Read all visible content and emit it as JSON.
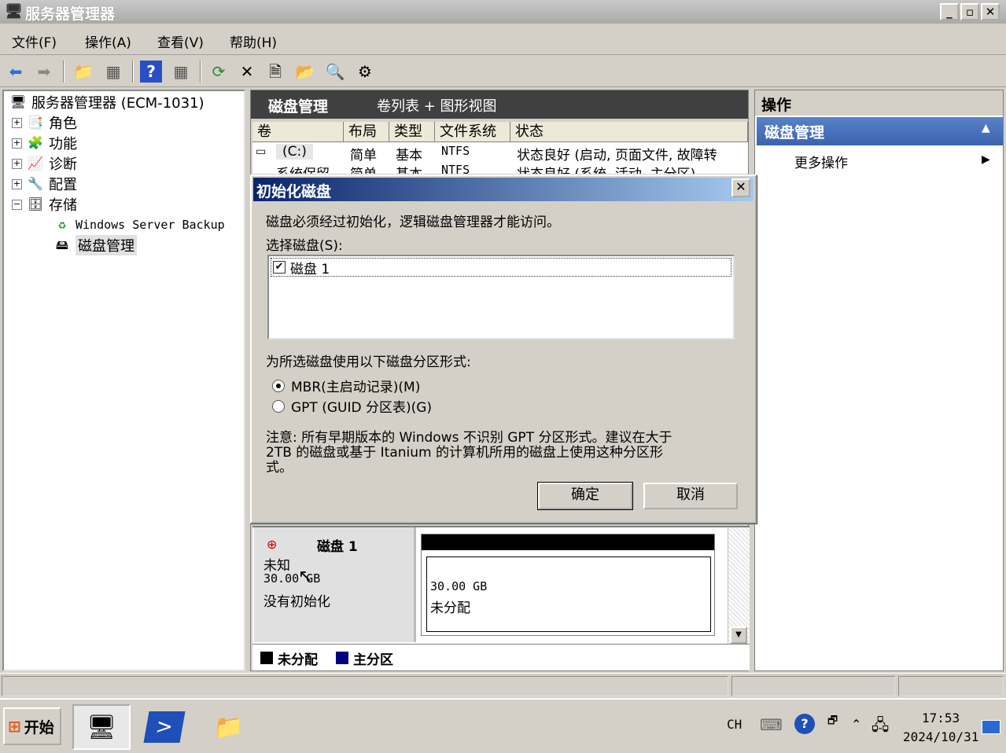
{
  "window": {
    "title": "服务器管理器",
    "buttons": {
      "minimize": "_",
      "restore": "▫",
      "close": "✕"
    }
  },
  "menu": [
    "文件(F)",
    "操作(A)",
    "查看(V)",
    "帮助(H)"
  ],
  "tree": {
    "root": "服务器管理器 (ECM-1031)",
    "items": [
      "角色",
      "功能",
      "诊断",
      "配置",
      "存储"
    ],
    "storage_children": [
      "Windows Server Backup",
      "磁盘管理"
    ]
  },
  "middle": {
    "title": "磁盘管理",
    "view": "卷列表 + 图形视图",
    "columns": [
      "卷",
      "布局",
      "类型",
      "文件系统",
      "状态"
    ],
    "rows": [
      [
        "(C:)",
        "简单",
        "基本",
        "NTFS",
        "状态良好 (启动, 页面文件, 故障转"
      ],
      [
        "系统保留",
        "简单",
        "基本",
        "NTFS",
        "状态良好 (系统, 活动, 主分区)"
      ]
    ],
    "disk": {
      "name": "磁盘 1",
      "type": "未知",
      "size": "30.00 GB",
      "status": "没有初始化"
    },
    "partition": {
      "size": "30.00 GB",
      "label": "未分配"
    },
    "legend": [
      "未分配",
      "主分区"
    ],
    "colors": {
      "unallocated": "#000000",
      "primary": "#000080"
    }
  },
  "actions": {
    "title": "操作",
    "section": "磁盘管理",
    "more": "更多操作"
  },
  "dialog": {
    "title": "初始化磁盘",
    "message": "磁盘必须经过初始化，逻辑磁盘管理器才能访问。",
    "select_label": "选择磁盘(S):",
    "disks": [
      {
        "label": "磁盘 1",
        "checked": true
      }
    ],
    "partition_label": "为所选磁盘使用以下磁盘分区形式:",
    "options": [
      {
        "label": "MBR(主启动记录)(M)",
        "selected": true
      },
      {
        "label": "GPT (GUID 分区表)(G)",
        "selected": false
      }
    ],
    "note_line1": "注意: 所有早期版本的 Windows 不识别 GPT 分区形式。建议在大于",
    "note_line2": "2TB 的磁盘或基于 Itanium 的计算机所用的磁盘上使用这种分区形",
    "note_line3": "式。",
    "ok": "确定",
    "cancel": "取消"
  },
  "taskbar": {
    "start": "开始",
    "lang": "CH",
    "time": "17:53",
    "date": "2024/10/31"
  }
}
